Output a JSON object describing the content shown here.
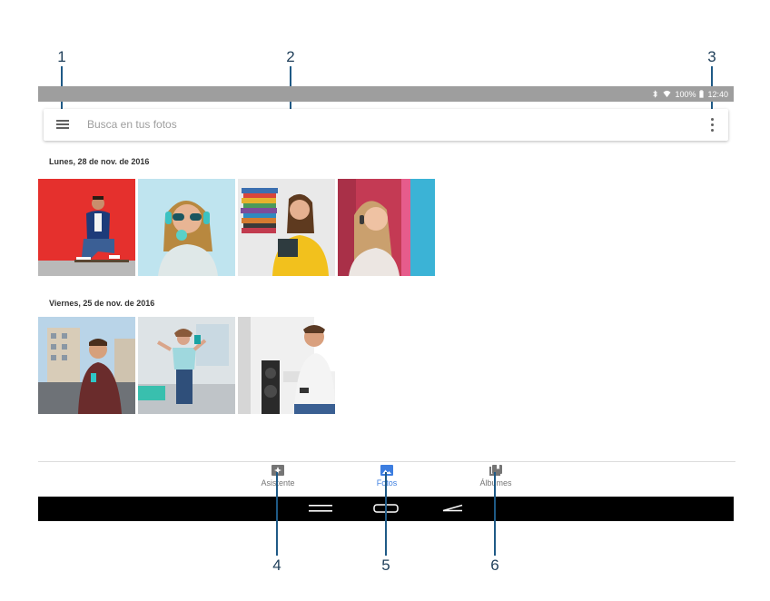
{
  "callouts": [
    "1",
    "2",
    "3",
    "4",
    "5",
    "6"
  ],
  "status_bar": {
    "battery": "100%",
    "time": "12:40",
    "icons": [
      "bluetooth-icon",
      "wifi-icon",
      "battery-icon"
    ]
  },
  "search": {
    "placeholder": "Busca en tus fotos",
    "menu_icon": "hamburger-menu-icon",
    "more_icon": "more-vert-icon"
  },
  "sections": [
    {
      "date": "Lunes, 28 de nov. de 2016",
      "photos": 4
    },
    {
      "date": "Viernes, 25 de nov. de 2016",
      "photos": 3
    }
  ],
  "bottom_nav": {
    "items": [
      {
        "label": "Asistente",
        "icon": "assistant-icon"
      },
      {
        "label": "Fotos",
        "icon": "photos-icon",
        "active": true
      },
      {
        "label": "Álbumes",
        "icon": "albums-icon"
      }
    ]
  },
  "colors": {
    "accent": "#3d7ee0",
    "status_bar": "#9e9e9e",
    "callout_line": "#1f5a86",
    "system_nav": "#000000"
  }
}
